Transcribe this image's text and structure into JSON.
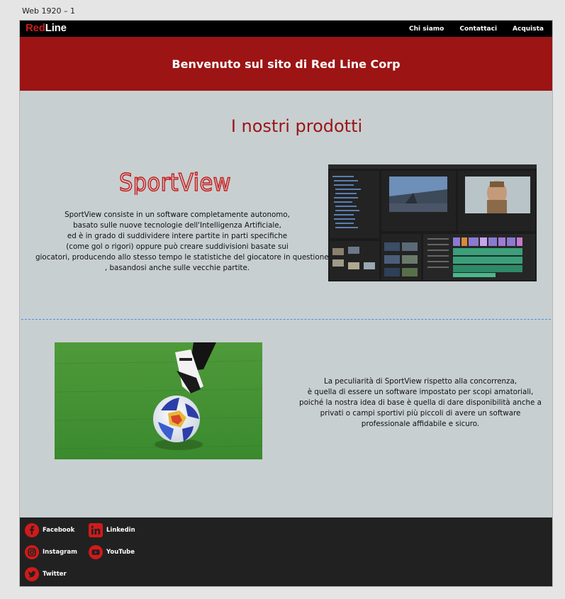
{
  "artboard": {
    "label": "Web 1920 – 1"
  },
  "navbar": {
    "logo": {
      "part1": "Red",
      "part2": "Line"
    },
    "links": [
      "Chi siamo",
      "Contattaci",
      "Acquista"
    ]
  },
  "hero": {
    "title": "Benvenuto sul sito di Red Line Corp"
  },
  "products": {
    "title": "I nostri prodotti",
    "product_logo": "SportView",
    "description_lines": [
      "SportView consiste in un software completamente autonomo,",
      "basato sulle nuove tecnologie dell'Intelligenza Artificiale,",
      "ed è in grado di suddividere intere partite in parti specifiche",
      "(come gol o rigori) oppure può creare suddivisioni basate sui",
      "giocatori, producendo allo stesso tempo le statistiche del giocatore in questione",
      ", basandosi anche sulle vecchie partite."
    ],
    "secondary_lines": [
      "La peculiarità di SportView rispetto alla concorrenza,",
      "è quella di essere un software impostato per scopi amatoriali,",
      "poiché la nostra idea di base è quella di dare disponibilità anche a",
      "privati o campi sportivi più piccoli di avere un software",
      "professionale affidabile e sicuro."
    ]
  },
  "footer": {
    "social": [
      "Facebook",
      "Linkedin",
      "Instagram",
      "YouTube",
      "Twitter"
    ]
  },
  "colors": {
    "brand_red": "#9c1414",
    "accent_red": "#c91d1d",
    "page_bg": "#c8cfd1",
    "footer_bg": "#212121"
  },
  "icons": {
    "facebook": "facebook-icon",
    "linkedin": "linkedin-icon",
    "instagram": "instagram-icon",
    "youtube": "youtube-icon",
    "twitter": "twitter-icon",
    "guide_handle": "equals-icon"
  }
}
